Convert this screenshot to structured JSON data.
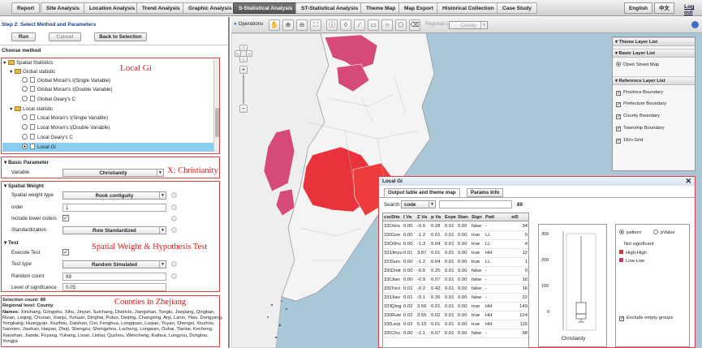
{
  "topnav": {
    "tabs": [
      "Report",
      "Site Analysis",
      "Location Analysis",
      "Trend Analysis",
      "Graphic Analysis",
      "S-Statistical Analysis",
      "ST-Statistical Analysis",
      "Theme Map",
      "Map Export",
      "Historical Collection",
      "Case Study"
    ],
    "active": "S-Statistical Analysis",
    "lang_en": "English",
    "lang_zh": "中文",
    "logout": "Log out"
  },
  "left": {
    "step_title": "Step 2: Select Method and Parameters",
    "run": "Run",
    "cancel": "Cancel",
    "back": "Back to Selection",
    "choose_method": "Choose method",
    "tree": {
      "root": "Spatial Statistics",
      "global": "Global statistic",
      "global_items": [
        "Global Moran's I(Single Variable)",
        "Global Moran's I(Double Variable)",
        "Global Geary's C"
      ],
      "local": "Local statistic",
      "local_items": [
        "Local Moran's I(Single Variable)",
        "Local Moran's I(Double Variable)",
        "Local Geary's C",
        "Local Gi"
      ],
      "selected": "Local Gi"
    },
    "basic_param": {
      "title": "Basic Parameter",
      "variable_label": "Variable",
      "variable_value": "Christianity"
    },
    "spatial_weight": {
      "title": "Spatial Weight",
      "type_label": "Spatial weight type",
      "type_value": "Rook contiguity",
      "order_label": "order",
      "order_value": "1",
      "include_label": "Include lower orders",
      "standardization_label": "Standardization",
      "standardization_value": "Row Standardized"
    },
    "test": {
      "title": "Test",
      "execute_label": "Execute Test",
      "type_label": "Test type",
      "type_value": "Random Simulated",
      "random_label": "Random count",
      "random_value": "99",
      "sig_label": "Level of significance",
      "sig_value": "0.05"
    },
    "selection": {
      "count": "Selection count: 89",
      "level": "Regional level: County",
      "names_label": "Names:",
      "names": "Xinchang, Gongshu, Xihu, Jinyun, Suichang, Districts, Jiangshan, Tonglu, Jiaojiang, Qingtian, Ruian, Leqing, Chunan, Xianju, Yuhuan, Dinghai, Putuo, Deqing, Changxing, Anji, Lanxi, Yiwu, Dongyang, Yongkang, Huangyan, Xiuzhou, Daishan, Cixi, Fenghua, Longquan, Luqiao, Yuyao, Shengsi, Xiuzhou, Sanmen, Jiashan, Haiyan, Zhuji, Shengzu, Shengzhou, Lucheng, Longwan, Ouhai, Tiantai, Kecheng, Xiaoshan, Jiande, Fuyang, Yuhang, Linan, Linhai, Quzhou, Wencheng, Kaihua, Longyou, Dongtou, Yongjia"
    },
    "annotations": {
      "local_gi": "Local Gi",
      "christianity": "X: Christianity",
      "weight_test": "Spatial Weight & Hypothesis Test",
      "counties": "Counties in Zhejiang"
    }
  },
  "map": {
    "toolbar": {
      "operations": "Operations",
      "regional_level_label": "Regional  Level",
      "regional_level_value": "County"
    },
    "layers": {
      "theme": "Theme Layer List",
      "basic": "Basic Layer List",
      "basic_items": [
        "Open Street Map"
      ],
      "reference": "Reference Layer List",
      "reference_items": [
        "Province Boundary",
        "Prefecture Boundary",
        "County Boundary",
        "Township Boundary",
        "1Km Grid"
      ]
    },
    "highlight_color": "#e8323c",
    "base_color": "#f2f2f2",
    "pink_color": "#d64a7a"
  },
  "localgi": {
    "title": "Local Gi",
    "tabs": [
      "Output table and theme map",
      "Params Info"
    ],
    "search_label": "Search",
    "search_field": "code",
    "count": "89",
    "columns": [
      "code",
      "Site",
      "I Va",
      "Z Va",
      "p Va",
      "Expe",
      "Stan",
      "Sign",
      "Patt",
      "st5"
    ],
    "rows": [
      [
        "330",
        "Xinc",
        "0.00",
        "-0.6",
        "0.28",
        "0.01",
        "0.00",
        "false",
        "-",
        "34"
      ],
      [
        "330",
        "Gon",
        "0.00",
        "-1.2",
        "0.01",
        "0.01",
        "0.00",
        "true",
        "LL",
        "0"
      ],
      [
        "330",
        "Xihu",
        "0.00",
        "-1.3",
        "0.04",
        "0.01",
        "0.00",
        "true",
        "LL",
        "4"
      ],
      [
        "331",
        "Jinyu",
        "0.01",
        "3.87",
        "0.01",
        "0.01",
        "0.00",
        "true",
        "HH",
        "12"
      ],
      [
        "331",
        "Suic",
        "0.00",
        "-1.2",
        "0.04",
        "0.01",
        "0.00",
        "true",
        "LL",
        "1"
      ],
      [
        "330",
        "Distr",
        "0.00",
        "-0.6",
        "0.25",
        "0.01",
        "0.00",
        "false",
        "-",
        "0"
      ],
      [
        "330",
        "Jian",
        "0.00",
        "-0.9",
        "0.07",
        "0.01",
        "0.00",
        "false",
        "-",
        "10"
      ],
      [
        "330",
        "Tonl",
        "0.01",
        "-0.2",
        "0.42",
        "0.01",
        "0.00",
        "false",
        "-",
        "16"
      ],
      [
        "331",
        "Jiao",
        "0.01",
        "-0.1",
        "0.35",
        "0.01",
        "0.00",
        "false",
        "-",
        "22"
      ],
      [
        "331",
        "Qing",
        "0.02",
        "3.56",
        "0.01",
        "0.01",
        "0.00",
        "true",
        "HH",
        "149"
      ],
      [
        "330",
        "Rule",
        "0.02",
        "3.55",
        "0.02",
        "0.01",
        "0.00",
        "true",
        "HH",
        "124"
      ],
      [
        "330",
        "Leqi",
        "0.02",
        "5.15",
        "0.01",
        "0.01",
        "0.00",
        "true",
        "HH",
        "115"
      ],
      [
        "330",
        "Chu",
        "0.00",
        "-1.1",
        "0.07",
        "0.01",
        "0.00",
        "false",
        "-",
        "98"
      ]
    ],
    "boxplot": {
      "variable": "Christianity",
      "ticks": [
        "300",
        "200",
        "100",
        "0"
      ]
    },
    "legend": {
      "pattern": "pattern",
      "pvalue": "pValue",
      "items": [
        "Not significant",
        "High-High",
        "Low-Low"
      ],
      "hh_color": "#e03030",
      "ll_color": "#d0306a",
      "exclude": "Exclude empty groups"
    }
  }
}
